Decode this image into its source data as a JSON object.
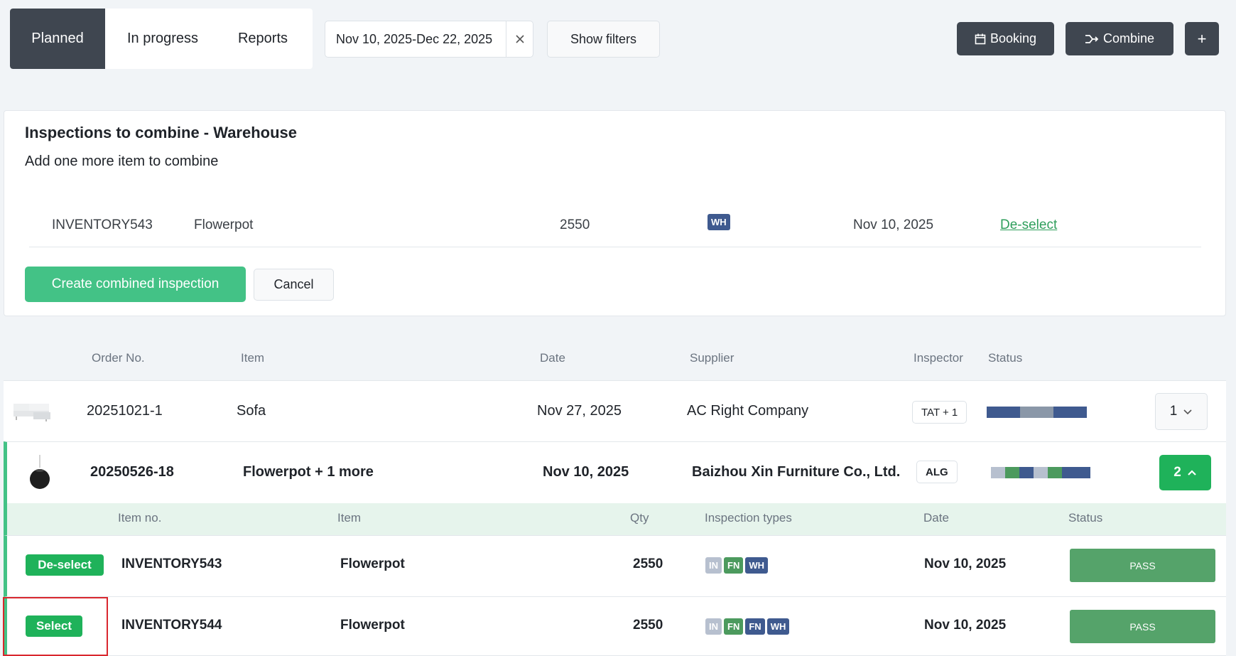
{
  "tabs": [
    {
      "label": "Planned",
      "active": true
    },
    {
      "label": "In progress",
      "active": false
    },
    {
      "label": "Reports",
      "active": false
    }
  ],
  "date_range": {
    "value": "Nov 10, 2025-Dec 22, 2025",
    "clear_icon": "close-icon"
  },
  "filters": {
    "show_label": "Show filters"
  },
  "actions": {
    "booking_label": "Booking",
    "combine_label": "Combine",
    "add_label": "+"
  },
  "combine_panel": {
    "title": "Inspections to combine - Warehouse",
    "subtitle": "Add one more item to combine",
    "selected_item": {
      "item_no": "INVENTORY543",
      "item": "Flowerpot",
      "qty": "2550",
      "type_badge": "WH",
      "date": "Nov 10, 2025",
      "action": "De-select"
    },
    "create_label": "Create combined inspection",
    "cancel_label": "Cancel"
  },
  "table": {
    "headers": {
      "order_no": "Order No.",
      "item": "Item",
      "date": "Date",
      "supplier": "Supplier",
      "inspector": "Inspector",
      "status": "Status"
    },
    "rows": [
      {
        "order_no": "20251021-1",
        "item": "Sofa",
        "date": "Nov 27, 2025",
        "supplier": "AC Right Company",
        "inspector": "TAT + 1",
        "count": "1",
        "expanded": false
      },
      {
        "order_no": "20250526-18",
        "item": "Flowerpot + 1 more",
        "date": "Nov 10, 2025",
        "supplier": "Baizhou Xin Furniture Co., Ltd.",
        "inspector": "ALG",
        "count": "2",
        "expanded": true
      }
    ]
  },
  "sub_table": {
    "headers": {
      "item_no": "Item no.",
      "item": "Item",
      "qty": "Qty",
      "types": "Inspection types",
      "date": "Date",
      "status": "Status"
    },
    "rows": [
      {
        "action": "De-select",
        "item_no": "INVENTORY543",
        "item": "Flowerpot",
        "qty": "2550",
        "types": [
          "IN",
          "FN",
          "WH"
        ],
        "date": "Nov 10, 2025",
        "status": "PASS"
      },
      {
        "action": "Select",
        "item_no": "INVENTORY544",
        "item": "Flowerpot",
        "qty": "2550",
        "types": [
          "IN",
          "FN",
          "FN",
          "WH"
        ],
        "date": "Nov 10, 2025",
        "status": "PASS"
      }
    ]
  },
  "colors": {
    "dark": "#3f4650",
    "green": "#1fb25a",
    "light_green": "#43c286",
    "pass": "#55a36a",
    "wh_badge": "#3f5a8f",
    "fn_badge": "#4c9a5e",
    "in_badge": "#b7c0cf",
    "highlight": "#d9272e"
  }
}
